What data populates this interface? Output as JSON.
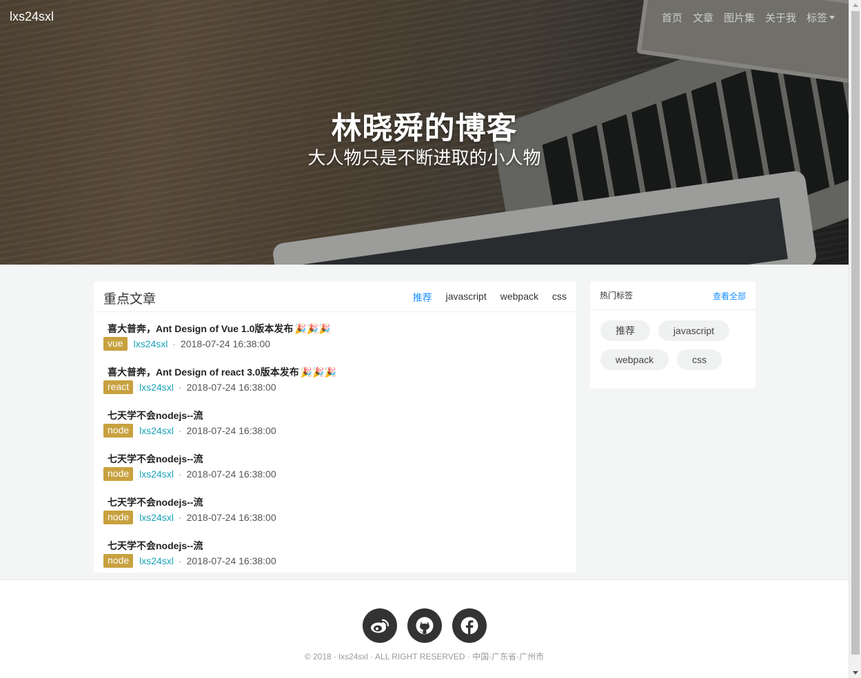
{
  "navbar": {
    "brand": "lxs24sxl",
    "links": [
      "首页",
      "文章",
      "图片集",
      "关于我"
    ],
    "dropdown_label": "标签"
  },
  "hero": {
    "title": "林晓舜的博客",
    "subtitle": "大人物只是不断进取的小人物"
  },
  "main": {
    "title": "重点文章",
    "tabs": [
      {
        "label": "推荐",
        "active": true
      },
      {
        "label": "javascript",
        "active": false
      },
      {
        "label": "webpack",
        "active": false
      },
      {
        "label": "css",
        "active": false
      }
    ],
    "articles": [
      {
        "title": "喜大普奔，Ant Design of Vue 1.0版本发布",
        "emoji": "🎉🎉🎉",
        "tag": "vue",
        "author": "lxs24sxl",
        "date": "2018-07-24 16:38:00"
      },
      {
        "title": "喜大普奔，Ant Design of react 3.0版本发布",
        "emoji": "🎉🎉🎉",
        "tag": "react",
        "author": "lxs24sxl",
        "date": "2018-07-24 16:38:00"
      },
      {
        "title": "七天学不会nodejs--流",
        "emoji": "",
        "tag": "node",
        "author": "lxs24sxl",
        "date": "2018-07-24 16:38:00"
      },
      {
        "title": "七天学不会nodejs--流",
        "emoji": "",
        "tag": "node",
        "author": "lxs24sxl",
        "date": "2018-07-24 16:38:00"
      },
      {
        "title": "七天学不会nodejs--流",
        "emoji": "",
        "tag": "node",
        "author": "lxs24sxl",
        "date": "2018-07-24 16:38:00"
      },
      {
        "title": "七天学不会nodejs--流",
        "emoji": "",
        "tag": "node",
        "author": "lxs24sxl",
        "date": "2018-07-24 16:38:00"
      }
    ],
    "separator": "·"
  },
  "side": {
    "title": "热门标签",
    "more": "查看全部",
    "tags": [
      "推荐",
      "javascript",
      "webpack",
      "css"
    ]
  },
  "footer": {
    "social": [
      "weibo-icon",
      "github-icon",
      "facebook-icon"
    ],
    "copyright": "© 2018 · lxs24sxl · ALL RIGHT RESERVED · 中国-广东省-广州市"
  },
  "colors": {
    "accent": "#1890ff",
    "author_link": "#17a2b8",
    "tag_badge": "#c8a13f",
    "social_bg": "#333333"
  }
}
